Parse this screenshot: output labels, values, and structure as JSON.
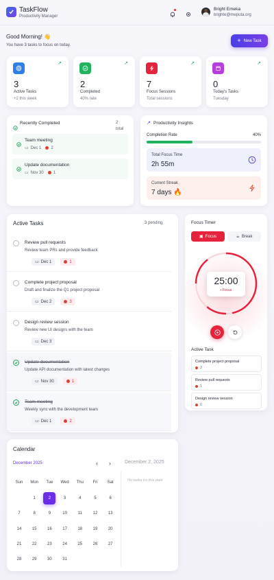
{
  "app": {
    "title": "TaskFlow",
    "subtitle": "Productivity Manager"
  },
  "user": {
    "name": "Bright Emeka",
    "email": "brighte@meputa.org"
  },
  "greeting": {
    "title": "Good Morning! 👋",
    "subtitle": "You have 3 tasks to focus on today."
  },
  "new_task_label": "New Task",
  "stats": [
    {
      "value": "3",
      "label": "Active Tasks",
      "sub": "+2 this week",
      "color": "#2f7fe6",
      "icon": "target-icon"
    },
    {
      "value": "2",
      "label": "Completed",
      "sub": "40% rate",
      "color": "#22b35e",
      "icon": "check-circle-icon"
    },
    {
      "value": "7",
      "label": "Focus Sessions",
      "sub": "Total sessions",
      "color": "#e6233c",
      "icon": "bolt-icon"
    },
    {
      "value": "0",
      "label": "Today's Tasks",
      "sub": "Tuesday",
      "color": "#b63ee0",
      "icon": "calendar-icon"
    }
  ],
  "recently_completed": {
    "title": "Recently Completed",
    "count": "2",
    "count_label": "total",
    "items": [
      {
        "title": "Team meeting",
        "date": "Dec 1",
        "pomodoros": "2"
      },
      {
        "title": "Update documentation",
        "date": "Nov 30",
        "pomodoros": "1"
      }
    ]
  },
  "insights": {
    "title": "Productivity Insights",
    "completion_label": "Completion Rate",
    "completion_value": "40%",
    "completion_fraction": 0.4,
    "focus_label": "Total Focus Time",
    "focus_value": "2h 55m",
    "streak_label": "Current Streak",
    "streak_value": "7 days 🔥"
  },
  "active_tasks": {
    "title": "Active Tasks",
    "pending": "3 pending",
    "items": [
      {
        "title": "Review pull requests",
        "desc": "Review team PRs and provide feedback",
        "date": "Dec 1",
        "pomodoros": "1",
        "done": false
      },
      {
        "title": "Complete project proposal",
        "desc": "Draft and finalize the Q1 project proposal",
        "date": "Dec 2",
        "pomodoros": "3",
        "done": false
      },
      {
        "title": "Design review session",
        "desc": "Review new UI designs with the team",
        "date": "Dec 3",
        "pomodoros": "",
        "done": false
      },
      {
        "title": "Update documentation",
        "desc": "Update API documentation with latest changes",
        "date": "Nov 30",
        "pomodoros": "1",
        "done": true
      },
      {
        "title": "Team meeting",
        "desc": "Weekly sync with the development team",
        "date": "Dec 1",
        "pomodoros": "2",
        "done": true
      }
    ]
  },
  "focus_timer": {
    "title": "Focus Timer",
    "tab_focus": "Focus",
    "tab_break": "Break",
    "time": "25:00",
    "mode": "Focus",
    "active_task_title": "Active Task",
    "active_tasks": [
      {
        "title": "Complete project proposal",
        "pomodoros": "3"
      },
      {
        "title": "Review pull requests",
        "pomodoros": "1"
      },
      {
        "title": "Design review session",
        "pomodoros": "0"
      }
    ]
  },
  "calendar": {
    "title": "Calendar",
    "month": "December 2025",
    "selected_date": "December 2, 2025",
    "no_tasks": "No tasks for this date",
    "weekdays": [
      "Sun",
      "Mon",
      "Tue",
      "Wed",
      "Thu",
      "Fri",
      "Sat"
    ],
    "weeks": [
      [
        "",
        "1",
        "2",
        "3",
        "4",
        "5",
        "6"
      ],
      [
        "7",
        "8",
        "9",
        "10",
        "11",
        "12",
        "13"
      ],
      [
        "14",
        "15",
        "16",
        "17",
        "18",
        "19",
        "20"
      ],
      [
        "21",
        "22",
        "23",
        "24",
        "25",
        "26",
        "27"
      ],
      [
        "28",
        "29",
        "30",
        "31",
        "",
        "",
        ""
      ]
    ],
    "selected_day": "2",
    "accent": "#6a2ee8"
  },
  "colors": {
    "accent": "#6a2ee8",
    "red": "#e6233c",
    "green": "#22a05a"
  }
}
